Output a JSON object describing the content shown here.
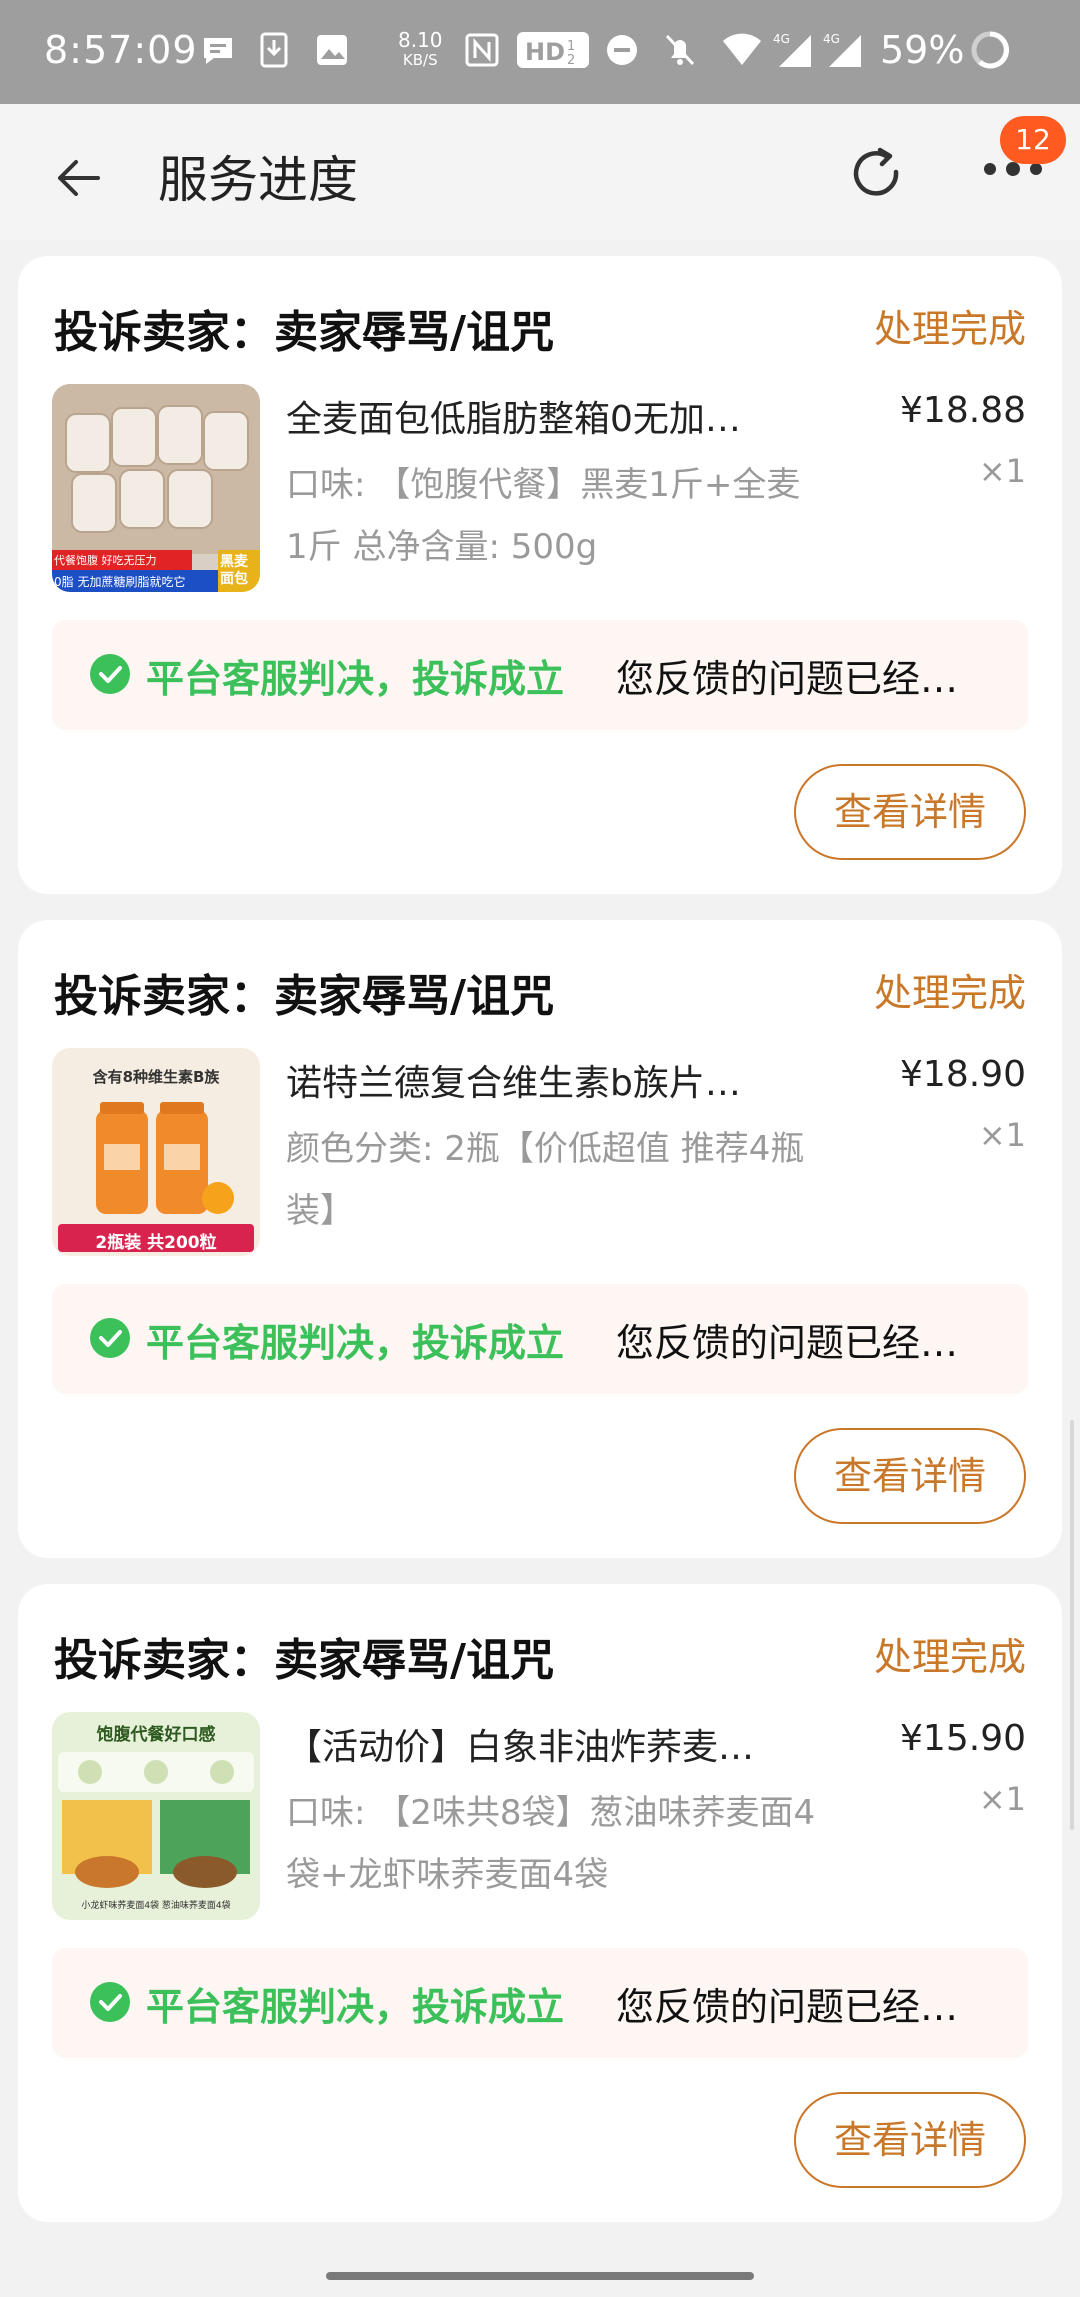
{
  "status_bar": {
    "time": "8:57:09",
    "net_speed_value": "8.10",
    "net_speed_unit": "KB/S",
    "battery": "59%",
    "icons": [
      "chat-bubble-icon",
      "download-icon",
      "image-icon",
      "nfc-icon",
      "hd-icon",
      "dnd-icon",
      "mute-icon",
      "wifi-icon",
      "signal-4g-icon",
      "signal-4g-icon",
      "battery-ring-icon"
    ]
  },
  "header": {
    "title": "服务进度",
    "badge_count": "12"
  },
  "cards": [
    {
      "title": "投诉卖家：卖家辱骂/诅咒",
      "status": "处理完成",
      "product_name": "全麦面包低脂肪整箱0无加…",
      "spec": "口味: 【饱腹代餐】黑麦1斤+全麦1斤 总净含量: 500g",
      "price": "¥18.88",
      "qty": "×1",
      "verdict": "平台客服判决，投诉成立",
      "message": "您反馈的问题已经…",
      "button": "查看详情",
      "thumb_top_text": "代餐饱腹 好吃无压力",
      "thumb_bottom_text": "0脂 无加蔗糖刷脂就吃它",
      "thumb_tag": "黑麦面包"
    },
    {
      "title": "投诉卖家：卖家辱骂/诅咒",
      "status": "处理完成",
      "product_name": "诺特兰德复合维生素b族片…",
      "spec": "颜色分类: 2瓶【价低超值 推荐4瓶装】",
      "price": "¥18.90",
      "qty": "×1",
      "verdict": "平台客服判决，投诉成立",
      "message": "您反馈的问题已经…",
      "button": "查看详情",
      "thumb_top_text": "含有8种维生素B族",
      "thumb_bottom_text": "2瓶装 共200粒"
    },
    {
      "title": "投诉卖家：卖家辱骂/诅咒",
      "status": "处理完成",
      "product_name": "【活动价】白象非油炸荞麦…",
      "spec": "口味: 【2味共8袋】葱油味荞麦面4袋+龙虾味荞麦面4袋",
      "price": "¥15.90",
      "qty": "×1",
      "verdict": "平台客服判决，投诉成立",
      "message": "您反馈的问题已经…",
      "button": "查看详情",
      "thumb_top_text": "饱腹代餐好口感",
      "thumb_bottom_text": "小龙虾味荞麦面4袋 葱油味荞麦面4袋"
    }
  ],
  "colors": {
    "accent": "#c9782a",
    "success": "#3bc05a",
    "badge": "#ff5a1f"
  }
}
